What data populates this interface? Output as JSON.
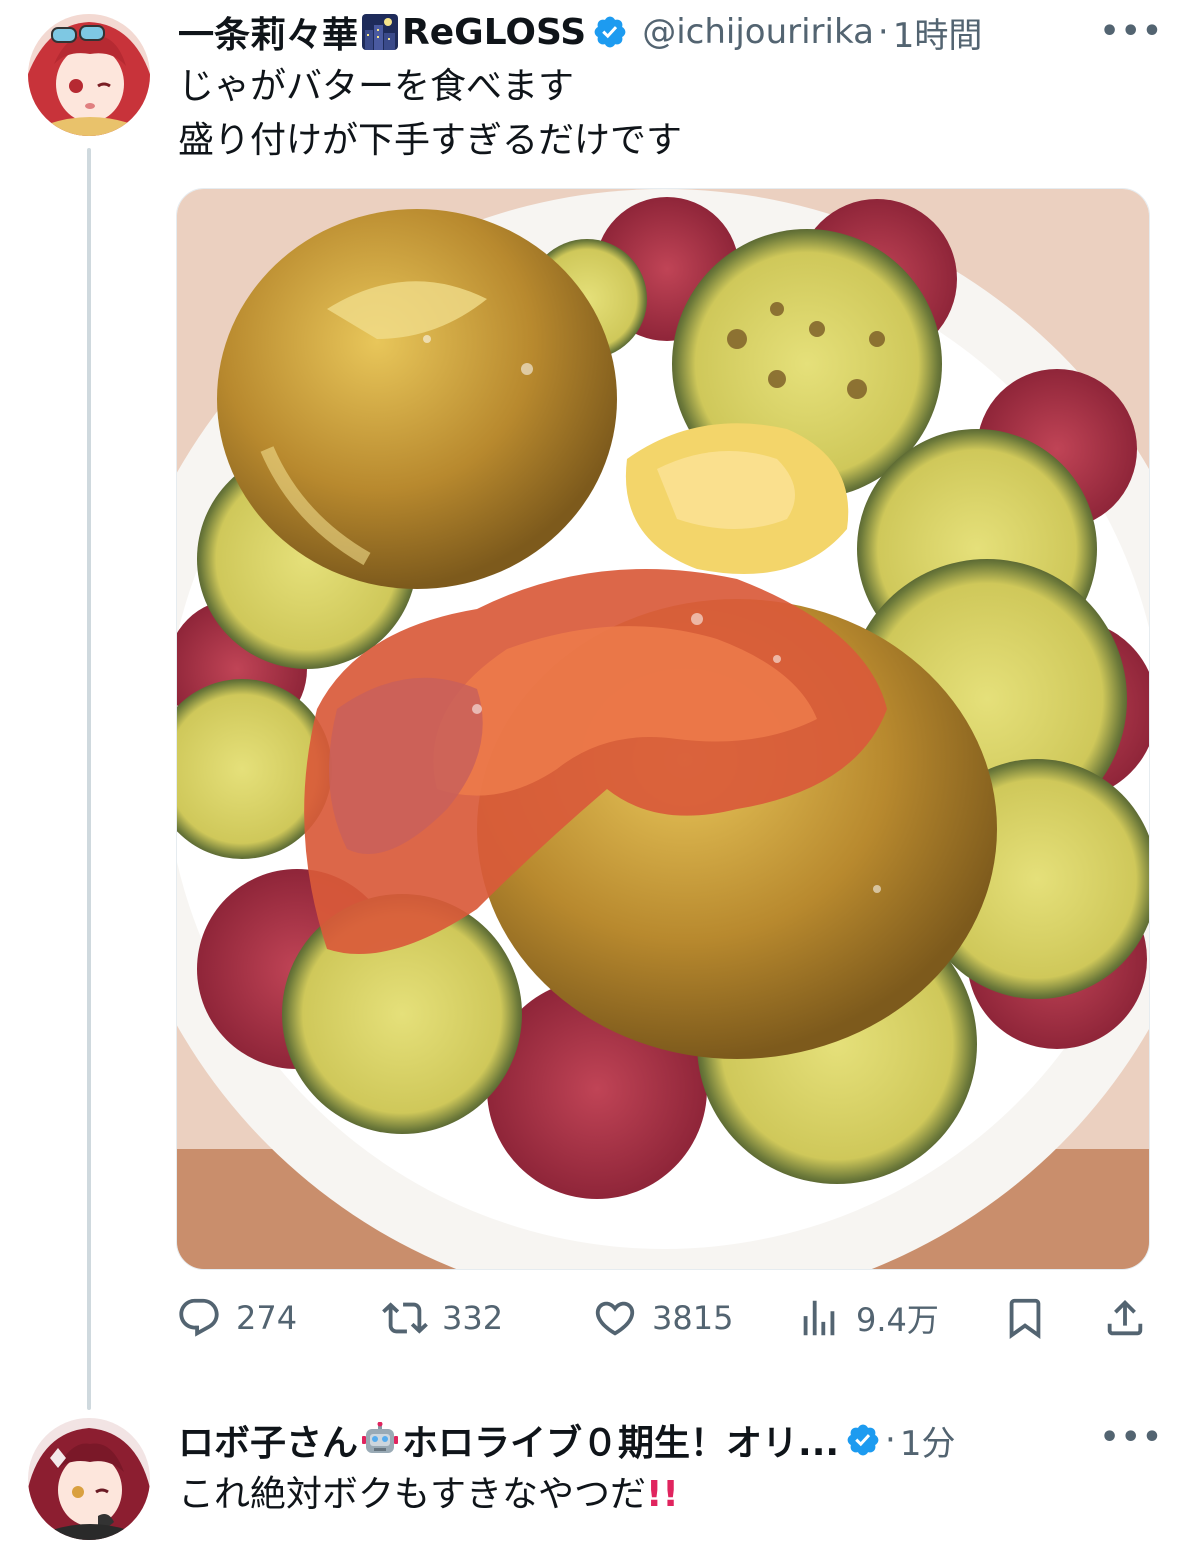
{
  "tweet": {
    "author_name": "一条莉々華",
    "author_emoji": "city-night-emoji",
    "author_suffix": "ReGLOSS",
    "handle": "@ichijouririka",
    "separator": "·",
    "time": "1時間",
    "more_label": "•••",
    "text_lines": [
      "じゃがバターを食べます",
      "盛り付けが下手すぎるだけです"
    ],
    "photo_subject": "potato-butter-plate",
    "stats": {
      "replies": "274",
      "retweets": "332",
      "likes": "3815",
      "views": "9.4万"
    }
  },
  "reply": {
    "author_name": "ロボ子さん",
    "author_emoji": "robot-emoji",
    "author_suffix": "ホロライブ０期生！オリ...",
    "separator": "·",
    "time": "1分",
    "more_label": "•••",
    "text": "これ絶対ボクもすきなやつだ",
    "text_emoji": "double-exclamation-emoji"
  },
  "colors": {
    "text_primary": "#0f1419",
    "text_secondary": "#536471",
    "verified_blue": "#1d9bf0",
    "thread_line": "#cfd9de"
  }
}
